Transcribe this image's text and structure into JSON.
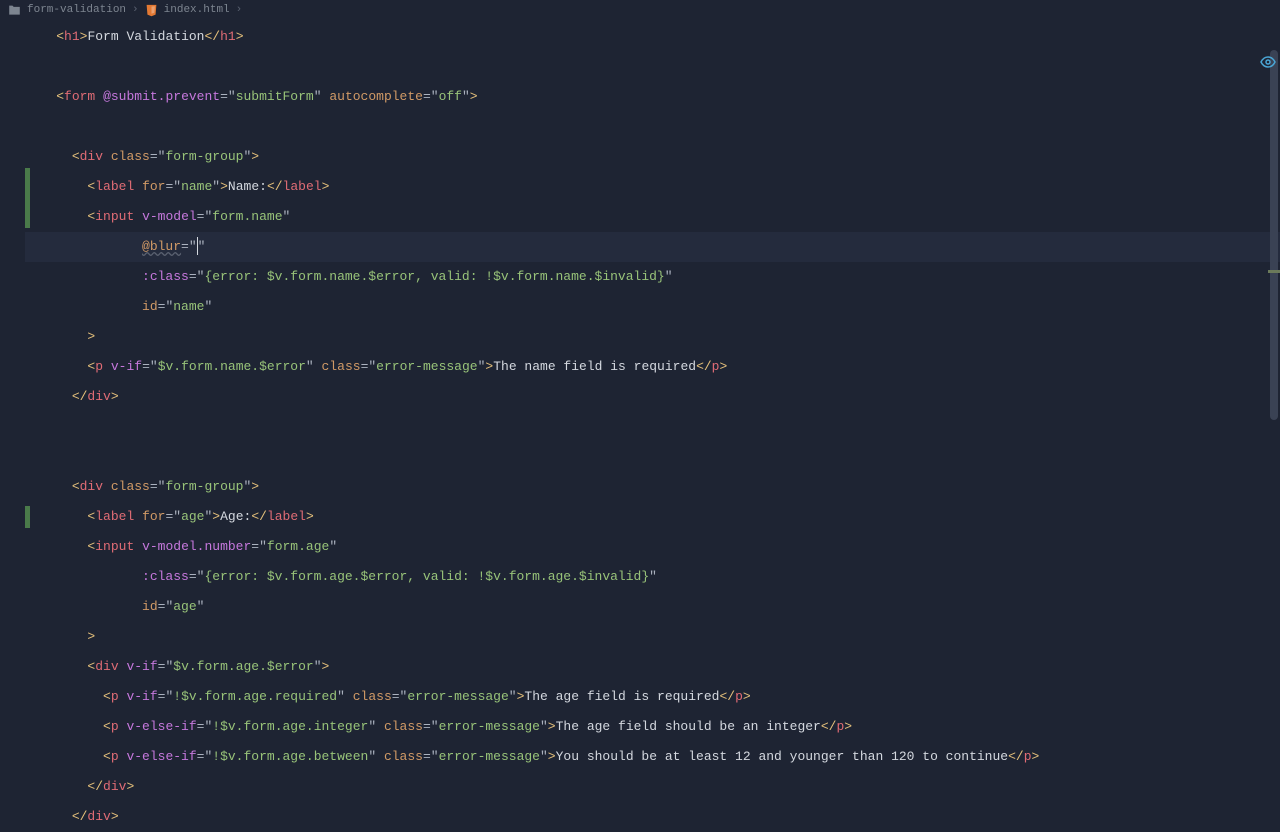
{
  "breadcrumb": {
    "folder": "form-validation",
    "file": "index.html"
  },
  "code": {
    "l1_h1_open": "<h1>",
    "l1_text": "Form Validation",
    "l1_h1_close": "</h1>",
    "l3_open": "<",
    "l3_tag": "form",
    "l3_sp": " ",
    "l3_a1": "@submit.prevent",
    "l3_eq": "=\"",
    "l3_v1": "submitForm",
    "l3_q": "\" ",
    "l3_a2": "autocomplete",
    "l3_v2": "off",
    "l3_end": "\">",
    "l5_div_open": "<div ",
    "l5_class": "class",
    "l5_val": "form-group",
    "l7_label_open": "<label ",
    "l7_for": "for",
    "l7_forval": "name",
    "l7_text": "Name:",
    "l7_label_close": "</label>",
    "l8_input": "<input ",
    "l8_vmodel": "v-model",
    "l8_vmodel_val": "form.name",
    "l9_blur": "@blur",
    "l9_blur_val": "",
    "l10_class": ":class",
    "l10_class_val": "{error: $v.form.name.$error, valid: !$v.form.name.$invalid}",
    "l11_id": "id",
    "l11_id_val": "name",
    "l12_close": ">",
    "l13_p_open": "<p ",
    "l13_vif": "v-if",
    "l13_vif_val": "$v.form.name.$error",
    "l13_class_val": "error-message",
    "l13_text": "The name field is required",
    "l13_p_close": "</p>",
    "l14_div_close": "</div>",
    "l18_for_val": "age",
    "l18_text": "Age:",
    "l19_vmodel": "v-model.number",
    "l19_vmodel_val": "form.age",
    "l20_class_val": "{error: $v.form.age.$error, valid: !$v.form.age.$invalid}",
    "l21_id_val": "age",
    "l23_vif_val": "$v.form.age.$error",
    "l24_vif_val": "!$v.form.age.required",
    "l24_text": "The age field is required",
    "l25_velseif": "v-else-if",
    "l25_vif_val": "!$v.form.age.integer",
    "l25_text": "The age field should be an integer",
    "l26_vif_val": "!$v.form.age.between",
    "l26_text": "You should be at least 12 and younger than 120 to continue"
  }
}
